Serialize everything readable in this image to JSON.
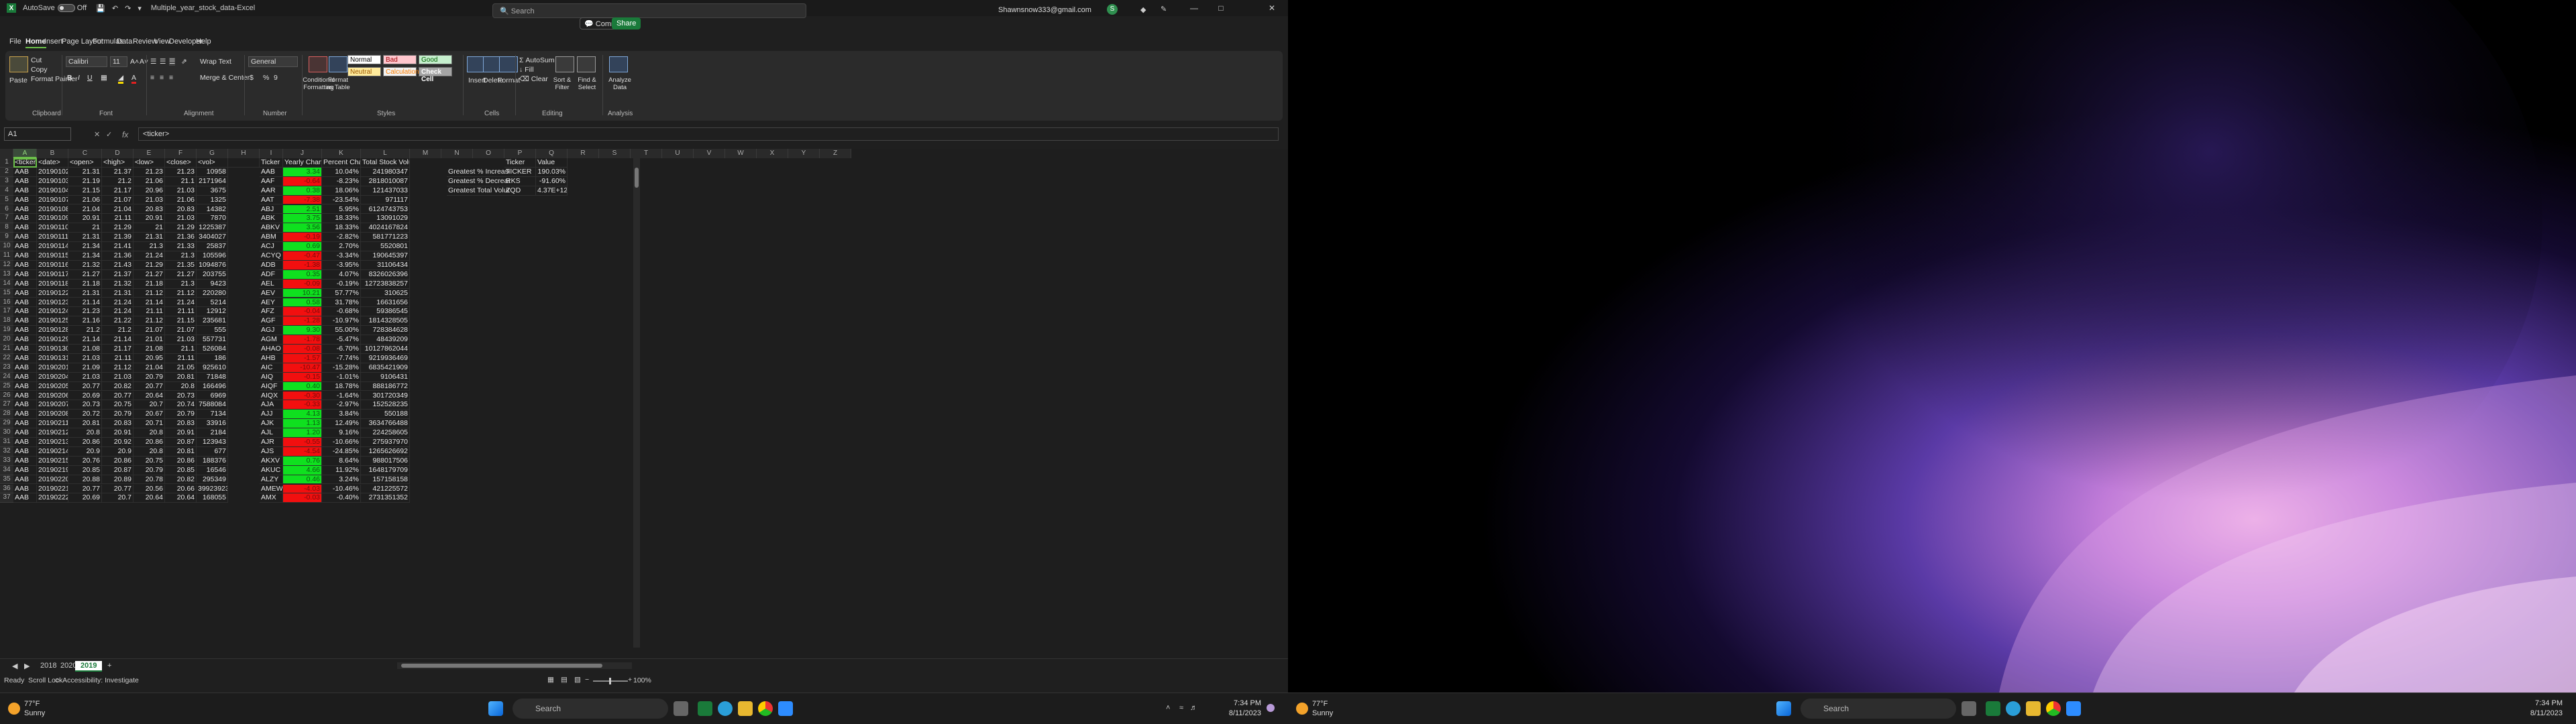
{
  "app": {
    "autosave_label": "AutoSave",
    "autosave_state": "Off",
    "filename": "Multiple_year_stock_data",
    "app_name": "Excel",
    "search_placeholder": "Search",
    "user_email": "Shawnsnow333@gmail.com",
    "avatar_letter": "S",
    "separator": " - "
  },
  "menu": [
    "File",
    "Home",
    "Insert",
    "Page Layout",
    "Formulas",
    "Data",
    "Review",
    "Developer",
    "Help"
  ],
  "top_buttons": {
    "comments": "Comments",
    "share": "Share"
  },
  "ribbon": {
    "clipboard": {
      "paste": "Paste",
      "cut": "Cut",
      "copy": "Copy",
      "format_painter": "Format Painter",
      "label": "Clipboard"
    },
    "font": {
      "name": "Calibri",
      "size": "11",
      "label": "Font"
    },
    "alignment": {
      "wrap": "Wrap Text",
      "merge": "Merge & Center",
      "label": "Alignment"
    },
    "number": {
      "format": "General",
      "label": "Number"
    },
    "styles": {
      "cond": "Conditional Formatting",
      "table": "Format as Table",
      "normal": "Normal",
      "bad": "Bad",
      "good": "Good",
      "neutral": "Neutral",
      "calculation": "Calculation",
      "check": "Check Cell",
      "label": "Styles"
    },
    "cells": {
      "insert": "Insert",
      "delete": "Delete",
      "format": "Format",
      "label": "Cells"
    },
    "editing": {
      "autosum": "AutoSum",
      "fill": "Fill",
      "clear": "Clear",
      "sort": "Sort & Filter",
      "find": "Find & Select",
      "label": "Editing"
    },
    "analysis": {
      "analyze": "Analyze Data",
      "label": "Analysis"
    }
  },
  "formula_bar": {
    "name_box": "A1",
    "fx": "fx",
    "content": "<ticker>"
  },
  "columns": [
    "A",
    "B",
    "C",
    "D",
    "E",
    "F",
    "G",
    "H",
    "I",
    "J",
    "K",
    "L",
    "M",
    "N",
    "O",
    "P",
    "Q",
    "R",
    "S",
    "T",
    "U",
    "V",
    "W",
    "X",
    "Y",
    "Z"
  ],
  "header_row": [
    "<ticker>",
    "<date>",
    "<open>",
    "<high>",
    "<low>",
    "<close>",
    "<vol>",
    "",
    "Ticker",
    "Yearly Change",
    "Percent Change",
    "Total Stock Volume"
  ],
  "rows": [
    [
      "AAB",
      "20190102",
      "21.31",
      "21.37",
      "21.23",
      "21.23",
      "10958",
      "AAB",
      "3.34",
      "10.04%",
      "241980347"
    ],
    [
      "AAB",
      "20190103",
      "21.19",
      "21.2",
      "21.06",
      "21.1",
      "2171964",
      "AAF",
      "-0.64",
      "-8.23%",
      "2818010087"
    ],
    [
      "AAB",
      "20190104",
      "21.15",
      "21.17",
      "20.96",
      "21.03",
      "3675",
      "AAR",
      "0.38",
      "18.06%",
      "121437033"
    ],
    [
      "AAB",
      "20190107",
      "21.06",
      "21.07",
      "21.03",
      "21.06",
      "1325",
      "AAT",
      "-7.38",
      "-23.54%",
      "971117"
    ],
    [
      "AAB",
      "20190108",
      "21.04",
      "21.04",
      "20.83",
      "20.83",
      "14382",
      "ABJ",
      "2.51",
      "5.95%",
      "6124743753"
    ],
    [
      "AAB",
      "20190109",
      "20.91",
      "21.11",
      "20.91",
      "21.03",
      "7870",
      "ABK",
      "3.75",
      "18.33%",
      "13091029"
    ],
    [
      "AAB",
      "20190110",
      "21",
      "21.29",
      "21",
      "21.29",
      "1225387",
      "ABKV",
      "3.56",
      "18.33%",
      "4024167824"
    ],
    [
      "AAB",
      "20190111",
      "21.31",
      "21.39",
      "21.31",
      "21.36",
      "3404027",
      "ABM",
      "-0.19",
      "-2.82%",
      "581771223"
    ],
    [
      "AAB",
      "20190114",
      "21.34",
      "21.41",
      "21.3",
      "21.33",
      "25837",
      "ACJ",
      "0.69",
      "2.70%",
      "5520801"
    ],
    [
      "AAB",
      "20190115",
      "21.34",
      "21.36",
      "21.24",
      "21.3",
      "105596",
      "ACYQ",
      "-0.47",
      "-3.34%",
      "190645397"
    ],
    [
      "AAB",
      "20190116",
      "21.32",
      "21.43",
      "21.29",
      "21.35",
      "1094876",
      "ADB",
      "-1.38",
      "-3.95%",
      "31106434"
    ],
    [
      "AAB",
      "20190117",
      "21.27",
      "21.37",
      "21.27",
      "21.27",
      "203755",
      "ADF",
      "0.35",
      "4.07%",
      "8326026396"
    ],
    [
      "AAB",
      "20190118",
      "21.18",
      "21.32",
      "21.18",
      "21.3",
      "9423",
      "AEL",
      "-0.09",
      "-0.19%",
      "12723838257"
    ],
    [
      "AAB",
      "20190122",
      "21.31",
      "21.31",
      "21.12",
      "21.12",
      "220280",
      "AEV",
      "10.21",
      "57.77%",
      "310625"
    ],
    [
      "AAB",
      "20190123",
      "21.14",
      "21.24",
      "21.14",
      "21.24",
      "5214",
      "AEY",
      "0.58",
      "31.78%",
      "16631656"
    ],
    [
      "AAB",
      "20190124",
      "21.23",
      "21.24",
      "21.11",
      "21.11",
      "12912",
      "AFZ",
      "-0.04",
      "-0.68%",
      "59386545"
    ],
    [
      "AAB",
      "20190125",
      "21.16",
      "21.22",
      "21.12",
      "21.15",
      "235681",
      "AGF",
      "-1.28",
      "-10.97%",
      "1814328505"
    ],
    [
      "AAB",
      "20190128",
      "21.2",
      "21.2",
      "21.07",
      "21.07",
      "555",
      "AGJ",
      "9.30",
      "55.00%",
      "728384628"
    ],
    [
      "AAB",
      "20190129",
      "21.14",
      "21.14",
      "21.01",
      "21.03",
      "557731",
      "AGM",
      "-1.78",
      "-5.47%",
      "48439209"
    ],
    [
      "AAB",
      "20190130",
      "21.08",
      "21.17",
      "21.08",
      "21.1",
      "526084",
      "AHAO",
      "-0.08",
      "-6.70%",
      "10127862044"
    ],
    [
      "AAB",
      "20190131",
      "21.03",
      "21.11",
      "20.95",
      "21.11",
      "186",
      "AHB",
      "-1.57",
      "-7.74%",
      "9219936469"
    ],
    [
      "AAB",
      "20190201",
      "21.09",
      "21.12",
      "21.04",
      "21.05",
      "925610",
      "AIC",
      "-10.47",
      "-15.28%",
      "6835421909"
    ],
    [
      "AAB",
      "20190204",
      "21.03",
      "21.03",
      "20.79",
      "20.81",
      "71848",
      "AIQ",
      "-0.15",
      "-1.01%",
      "9106431"
    ],
    [
      "AAB",
      "20190205",
      "20.77",
      "20.82",
      "20.77",
      "20.8",
      "166496",
      "AIQF",
      "0.40",
      "18.78%",
      "888186772"
    ],
    [
      "AAB",
      "20190206",
      "20.69",
      "20.77",
      "20.64",
      "20.73",
      "6969",
      "AIQX",
      "-0.30",
      "-1.64%",
      "301720349"
    ],
    [
      "AAB",
      "20190207",
      "20.73",
      "20.75",
      "20.7",
      "20.74",
      "7588084",
      "AJA",
      "-0.33",
      "-2.97%",
      "152528235"
    ],
    [
      "AAB",
      "20190208",
      "20.72",
      "20.79",
      "20.67",
      "20.79",
      "7134",
      "AJJ",
      "4.13",
      "3.84%",
      "550188"
    ],
    [
      "AAB",
      "20190211",
      "20.81",
      "20.83",
      "20.71",
      "20.83",
      "33916",
      "AJK",
      "1.13",
      "12.49%",
      "3634766488"
    ],
    [
      "AAB",
      "20190212",
      "20.8",
      "20.91",
      "20.8",
      "20.91",
      "2184",
      "AJL",
      "1.20",
      "9.16%",
      "224258605"
    ],
    [
      "AAB",
      "20190213",
      "20.86",
      "20.92",
      "20.86",
      "20.87",
      "123943",
      "AJR",
      "-0.55",
      "-10.66%",
      "275937970"
    ],
    [
      "AAB",
      "20190214",
      "20.9",
      "20.9",
      "20.8",
      "20.81",
      "677",
      "AJS",
      "-4.54",
      "-24.85%",
      "1265626692"
    ],
    [
      "AAB",
      "20190215",
      "20.76",
      "20.86",
      "20.75",
      "20.86",
      "188376",
      "AKXV",
      "0.76",
      "8.64%",
      "988017506"
    ],
    [
      "AAB",
      "20190219",
      "20.85",
      "20.87",
      "20.79",
      "20.85",
      "16546",
      "AKUC",
      "4.66",
      "11.92%",
      "1648179709"
    ],
    [
      "AAB",
      "20190220",
      "20.88",
      "20.89",
      "20.78",
      "20.82",
      "295349",
      "ALZY",
      "0.46",
      "3.24%",
      "157158158"
    ],
    [
      "AAB",
      "20190221",
      "20.77",
      "20.77",
      "20.56",
      "20.66",
      "39923923",
      "AMEW",
      "-4.03",
      "-10.46%",
      "421225572"
    ],
    [
      "AAB",
      "20190222",
      "20.69",
      "20.7",
      "20.64",
      "20.64",
      "168055",
      "AMX",
      "-0.03",
      "-0.40%",
      "2731351352"
    ]
  ],
  "summary": {
    "headers": [
      "Ticker",
      "Value"
    ],
    "rows": [
      [
        "Greatest % Increase",
        "TICKER",
        "190.03%"
      ],
      [
        "Greatest % Decrease",
        "RKS",
        "-91.60%"
      ],
      [
        "Greatest Total Volume",
        "ZQD",
        "4.37E+12"
      ]
    ]
  },
  "sheets": [
    "2018",
    "2020",
    "2019"
  ],
  "active_sheet": "2019",
  "status": {
    "ready": "Ready",
    "scroll_lock": "Scroll Lock",
    "accessibility": "Accessibility: Investigate",
    "zoom": "100%"
  },
  "taskbar": {
    "temp": "77°F",
    "weather": "Sunny",
    "search": "Search",
    "time": "7:34 PM",
    "date": "8/11/2023"
  },
  "colors": {
    "excel_green": "#1a7a3a",
    "positive": "#0fe01f",
    "negative": "#f20f0f"
  }
}
